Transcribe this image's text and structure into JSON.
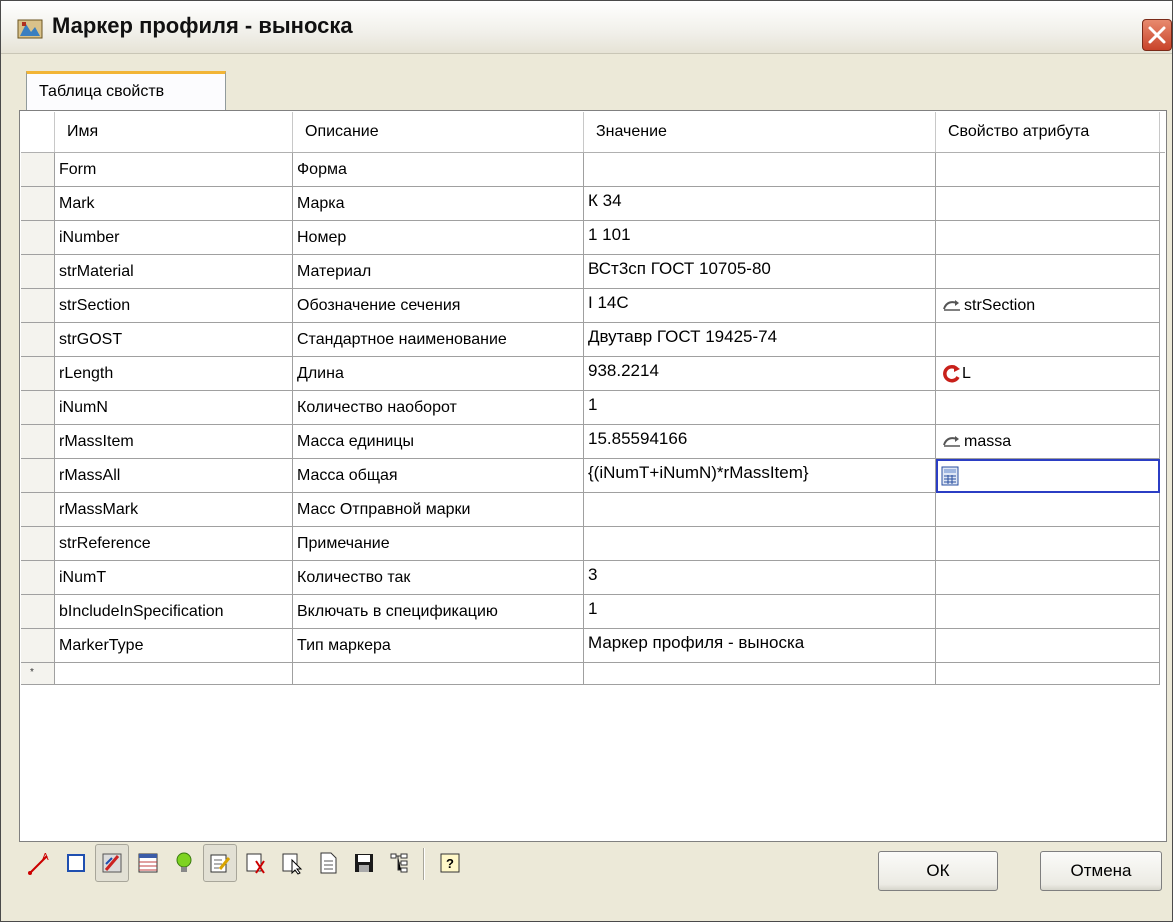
{
  "window": {
    "title": "Маркер профиля - выноска"
  },
  "tabs": [
    {
      "label": "Таблица свойств"
    }
  ],
  "table": {
    "columns": [
      "Имя",
      "Описание",
      "Значение",
      "Свойство атрибута"
    ],
    "rows": [
      {
        "name": "Form",
        "description": "Форма",
        "value": "",
        "attribute": ""
      },
      {
        "name": "Mark",
        "description": "Марка",
        "value": "К 34",
        "attribute": ""
      },
      {
        "name": "iNumber",
        "description": "Номер",
        "value": "1 101",
        "attribute": ""
      },
      {
        "name": "strMaterial",
        "description": "Материал",
        "value": "ВСт3сп ГОСТ 10705-80",
        "attribute": ""
      },
      {
        "name": "strSection",
        "description": "Обозначение сечения",
        "value": "I 14С",
        "attribute": "strSection",
        "attribute_icon": "link-arrow-icon"
      },
      {
        "name": "strGOST",
        "description": "Стандартное наименование",
        "value": "Двутавр ГОСТ 19425-74",
        "attribute": ""
      },
      {
        "name": "rLength",
        "description": "Длина",
        "value": "938.2214",
        "attribute": "L",
        "attribute_icon": "refresh-red-icon"
      },
      {
        "name": "iNumN",
        "description": "Количество наоборот",
        "value": "1",
        "attribute": ""
      },
      {
        "name": "rMassItem",
        "description": "Масса единицы",
        "value": "15.85594166",
        "attribute": "massa",
        "attribute_icon": "link-arrow-icon"
      },
      {
        "name": "rMassAll",
        "description": "Масса общая",
        "value": "{(iNumT+iNumN)*rMassItem}",
        "attribute": "",
        "attribute_icon": "calculator-icon",
        "selected": true
      },
      {
        "name": "rMassMark",
        "description": "Масс Отправной марки",
        "value": "",
        "attribute": ""
      },
      {
        "name": "strReference",
        "description": "Примечание",
        "value": "",
        "attribute": ""
      },
      {
        "name": "iNumT",
        "description": "Количество так",
        "value": "3",
        "attribute": ""
      },
      {
        "name": "bIncludeInSpecification",
        "description": "Включать в спецификацию",
        "value": "1",
        "attribute": ""
      },
      {
        "name": "MarkerType",
        "description": "Тип маркера",
        "value": "Маркер профиля - выноска",
        "attribute": ""
      }
    ],
    "new_row_marker": "*"
  },
  "toolbar": {
    "icons": [
      "line-icon",
      "rectangle-icon",
      "brush-icon",
      "table-icon",
      "lightbulb-icon",
      "edit-icon",
      "select-icon",
      "pointer-icon",
      "document-icon",
      "save-icon",
      "tree-icon",
      "help-icon"
    ]
  },
  "buttons": {
    "ok": "ОК",
    "cancel": "Отмена"
  },
  "colors": {
    "selection_border": "#2b3ec4",
    "tab_accent": "#f2b536",
    "close_button": "#c8432a"
  }
}
